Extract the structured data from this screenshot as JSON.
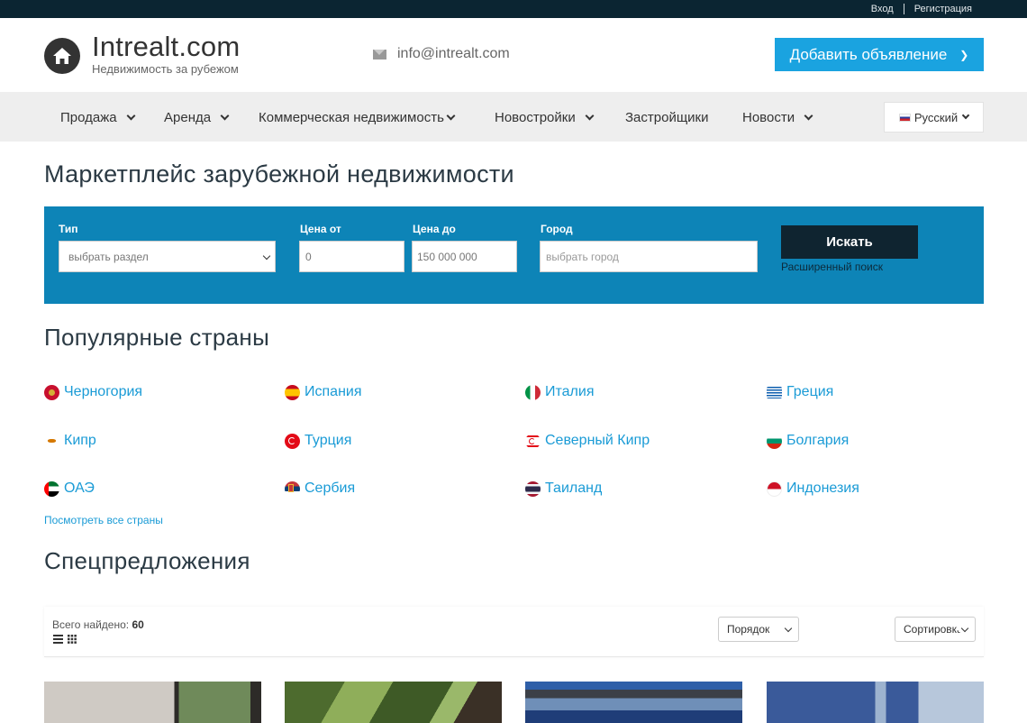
{
  "topbar": {
    "login": "Вход",
    "register": "Регистрация"
  },
  "header": {
    "brand": "Intrealt.com",
    "tagline": "Недвижимость за рубежом",
    "email": "info@intrealt.com",
    "add_listing": "Добавить объявление",
    "add_listing_icon": "chevron-right-icon"
  },
  "nav": {
    "items": [
      {
        "label": "Продажа",
        "dropdown": true
      },
      {
        "label": "Аренда",
        "dropdown": true
      },
      {
        "label": "Коммерческая недвижимость",
        "dropdown": true
      },
      {
        "label": "Новостройки",
        "dropdown": true
      },
      {
        "label": "Застройщики",
        "dropdown": false
      },
      {
        "label": "Новости",
        "dropdown": true
      }
    ],
    "language": "Русский"
  },
  "page_title": "Маркетплейс зарубежной недвижимости",
  "search": {
    "type_label": "Тип",
    "type_value": "выбрать раздел",
    "price_from_label": "Цена от",
    "price_from_value": "0",
    "price_to_label": "Цена до",
    "price_to_value": "150 000 000",
    "city_label": "Город",
    "city_placeholder": "выбрать город",
    "search_button": "Искать",
    "advanced": "Расширенный поиск"
  },
  "popular": {
    "title": "Популярные страны",
    "countries": [
      {
        "name": "Черногория",
        "flag": "montenegro-flag-icon"
      },
      {
        "name": "Испания",
        "flag": "spain-flag-icon"
      },
      {
        "name": "Италия",
        "flag": "italy-flag-icon"
      },
      {
        "name": "Греция",
        "flag": "greece-flag-icon"
      },
      {
        "name": "Кипр",
        "flag": "cyprus-flag-icon"
      },
      {
        "name": "Турция",
        "flag": "turkey-flag-icon"
      },
      {
        "name": "Северный Кипр",
        "flag": "north-cyprus-flag-icon"
      },
      {
        "name": "Болгария",
        "flag": "bulgaria-flag-icon"
      },
      {
        "name": "ОАЭ",
        "flag": "uae-flag-icon"
      },
      {
        "name": "Сербия",
        "flag": "serbia-flag-icon"
      },
      {
        "name": "Таиланд",
        "flag": "thailand-flag-icon"
      },
      {
        "name": "Индонезия",
        "flag": "indonesia-flag-icon"
      }
    ],
    "view_all": "Посмотреть все страны"
  },
  "offers": {
    "title": "Спецпредложения",
    "found_label": "Всего найдено:",
    "found_count": "60",
    "order_select": "Порядок",
    "sort_select": "Сортировка"
  },
  "colors": {
    "accent": "#1aa3e0",
    "search_bg": "#0d84b7",
    "topbar_bg": "#0b2532",
    "link": "#1a9bd6"
  }
}
